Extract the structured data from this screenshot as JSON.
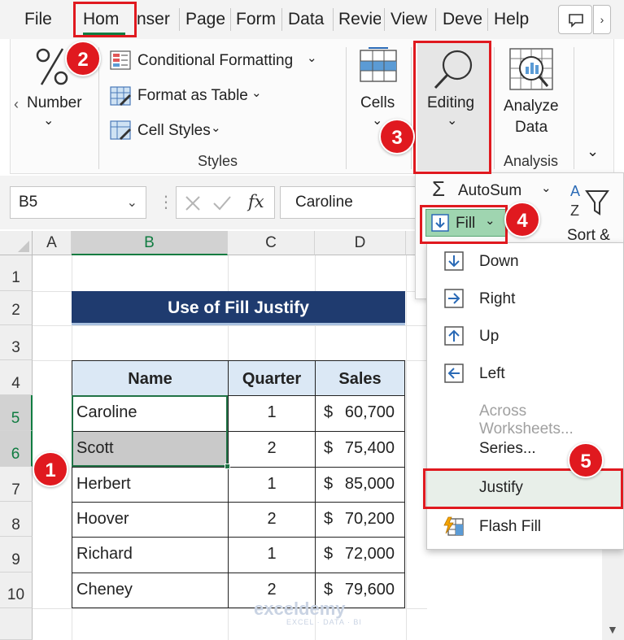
{
  "tabs": [
    {
      "label": "File"
    },
    {
      "label": "Hom"
    },
    {
      "label": "nser"
    },
    {
      "label": "Page"
    },
    {
      "label": "Form"
    },
    {
      "label": "Data"
    },
    {
      "label": "Revie"
    },
    {
      "label": "View"
    },
    {
      "label": "Deve"
    },
    {
      "label": "Help"
    }
  ],
  "tab_scroll_glyph": "›",
  "ribbon": {
    "number_label": "Number",
    "number_icon": "percent-icon",
    "styles": {
      "conditional_formatting": "Conditional Formatting",
      "format_as_table": "Format as Table",
      "cell_styles": "Cell Styles",
      "group_label": "Styles"
    },
    "cells_label": "Cells",
    "editing_label": "Editing",
    "analyze_label_1": "Analyze",
    "analyze_label_2": "Data",
    "analysis_group_label": "Analysis",
    "dropdown_glyph": "⌄",
    "left_scroll_glyph": "‹"
  },
  "formula_bar": {
    "name_box": "B5",
    "fx": "fx",
    "content": "Caroline"
  },
  "columns": [
    "A",
    "B",
    "C",
    "D"
  ],
  "rows": [
    "1",
    "2",
    "3",
    "4",
    "5",
    "6",
    "7",
    "8",
    "9",
    "10"
  ],
  "sheet": {
    "title": "Use of Fill Justify",
    "headers": [
      "Name",
      "Quarter",
      "Sales"
    ],
    "data": [
      {
        "name": "Caroline",
        "quarter": "1",
        "sales": "60,700"
      },
      {
        "name": "Scott",
        "quarter": "2",
        "sales": "75,400"
      },
      {
        "name": "Herbert",
        "quarter": "1",
        "sales": "85,000"
      },
      {
        "name": "Hoover",
        "quarter": "2",
        "sales": "70,200"
      },
      {
        "name": "Richard",
        "quarter": "1",
        "sales": "72,000"
      },
      {
        "name": "Cheney",
        "quarter": "2",
        "sales": "79,600"
      }
    ],
    "currency": "$"
  },
  "editing_panel": {
    "autosum": "AutoSum",
    "fill": "Fill",
    "sort_label": "Sort &"
  },
  "fill_menu": [
    {
      "label": "Down",
      "icon": "fill-down-icon",
      "disabled": false
    },
    {
      "label": "Right",
      "icon": "fill-right-icon",
      "disabled": false
    },
    {
      "label": "Up",
      "icon": "fill-up-icon",
      "disabled": false
    },
    {
      "label": "Left",
      "icon": "fill-left-icon",
      "disabled": false
    },
    {
      "label": "Across Worksheets...",
      "icon": "",
      "disabled": true
    },
    {
      "label": "Series...",
      "icon": "",
      "disabled": false
    },
    {
      "label": "Justify",
      "icon": "",
      "disabled": false
    },
    {
      "label": "Flash Fill",
      "icon": "flash-fill-icon",
      "disabled": false
    }
  ],
  "callouts": [
    "1",
    "2",
    "3",
    "4",
    "5"
  ],
  "watermark": {
    "brand": "exceldemy",
    "tagline": "EXCEL · DATA · BI"
  },
  "colors": {
    "accent_green": "#107c41",
    "callout_red": "#e0191f",
    "title_fill": "#1f3b6f",
    "header_fill": "#dbe8f5",
    "fill_button": "#9fd5b0"
  }
}
